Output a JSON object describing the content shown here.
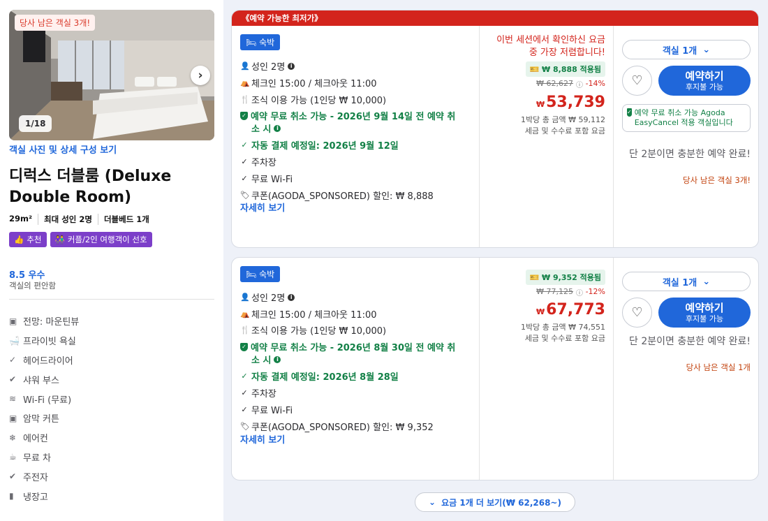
{
  "photo": {
    "scarcity": "당사 남은 객실 3개!",
    "counter": "1/18",
    "link": "객실 사진 및 상세 구성 보기"
  },
  "room": {
    "name": "디럭스 더블룸 (Deluxe Double Room)",
    "size": "29m²",
    "max_adults": "최대 성인 2명",
    "bed": "더블베드 1개",
    "tags": [
      "추천",
      "커플/2인 여행객이 선호"
    ],
    "score": "8.5 우수",
    "score_sub": "객실의 편안함",
    "amenities": [
      {
        "icon": "view-icon",
        "label": "전망: 마운틴뷰"
      },
      {
        "icon": "bath-icon",
        "label": "프라이빗 욕실"
      },
      {
        "icon": "check-icon",
        "label": "헤어드라이어"
      },
      {
        "icon": "check-circle-icon",
        "label": "샤워 부스"
      },
      {
        "icon": "wifi-icon",
        "label": "Wi-Fi (무료)"
      },
      {
        "icon": "curtain-icon",
        "label": "암막 커튼"
      },
      {
        "icon": "ac-icon",
        "label": "에어컨"
      },
      {
        "icon": "tea-icon",
        "label": "무료 차"
      },
      {
        "icon": "check-circle-icon",
        "label": "주전자"
      },
      {
        "icon": "fridge-icon",
        "label": "냉장고"
      }
    ]
  },
  "offers": [
    {
      "banner": "《예약 가능한 최저가》",
      "stay": "숙박",
      "adults": "성인 2명",
      "checkin": "체크인 15:00 / 체크아웃 11:00",
      "breakfast": "조식 이용 가능 (1인당 ₩ 10,000)",
      "cancel_line1": "예약 무료 취소 가능 - 2026년 9월 14일 전 예약 취",
      "cancel_line2": "소 시",
      "autopay": "자동 결제 예정일: 2026년 9월 12일",
      "parking": "주차장",
      "wifi": "무료 Wi-Fi",
      "coupon_text": "쿠폰(AGODA_SPONSORED) 할인: ₩ 8,888",
      "details": "자세히 보기",
      "lowest_msg": "이번 세션에서 확인하신 요금 중 가장 저렴합니다!",
      "coupon_badge": "₩ 8,888 적용됨",
      "original": "₩ 62,627",
      "discount": "-14%",
      "currency": "₩",
      "price": "53,739",
      "total": "1박당 총 금액 ₩ 59,112",
      "tax": "세금 및 수수료 포함 요금",
      "rooms": "객실 1개",
      "book": "예약하기",
      "book_sub": "후지불 가능",
      "cancel_box": "예약 무료 취소 가능 Agoda EasyCancel 적용 객실입니다",
      "hurry": "단 2분이면 충분한 예약 완료!",
      "left": "당사 남은 객실 3개!"
    },
    {
      "stay": "숙박",
      "adults": "성인 2명",
      "checkin": "체크인 15:00 / 체크아웃 11:00",
      "breakfast": "조식 이용 가능 (1인당 ₩ 10,000)",
      "cancel_line1": "예약 무료 취소 가능 - 2026년 8월 30일 전 예약 취",
      "cancel_line2": "소 시",
      "autopay": "자동 결제 예정일: 2026년 8월 28일",
      "parking": "주차장",
      "wifi": "무료 Wi-Fi",
      "coupon_text": "쿠폰(AGODA_SPONSORED) 할인: ₩ 9,352",
      "details": "자세히 보기",
      "coupon_badge": "₩ 9,352 적용됨",
      "original": "₩ 77,125",
      "discount": "-12%",
      "currency": "₩",
      "price": "67,773",
      "total": "1박당 총 금액 ₩ 74,551",
      "tax": "세금 및 수수료 포함 요금",
      "rooms": "객실 1개",
      "book": "예약하기",
      "book_sub": "후지불 가능",
      "hurry": "단 2분이면 충분한 예약 완료!",
      "left": "당사 남은 객실 1개"
    }
  ],
  "more_rates": "요금 1개 더 보기(₩ 62,268~)",
  "colors": {
    "brand": "#2067da",
    "sale": "#d3241c",
    "green": "#128046",
    "purple": "#7c3fc9"
  }
}
